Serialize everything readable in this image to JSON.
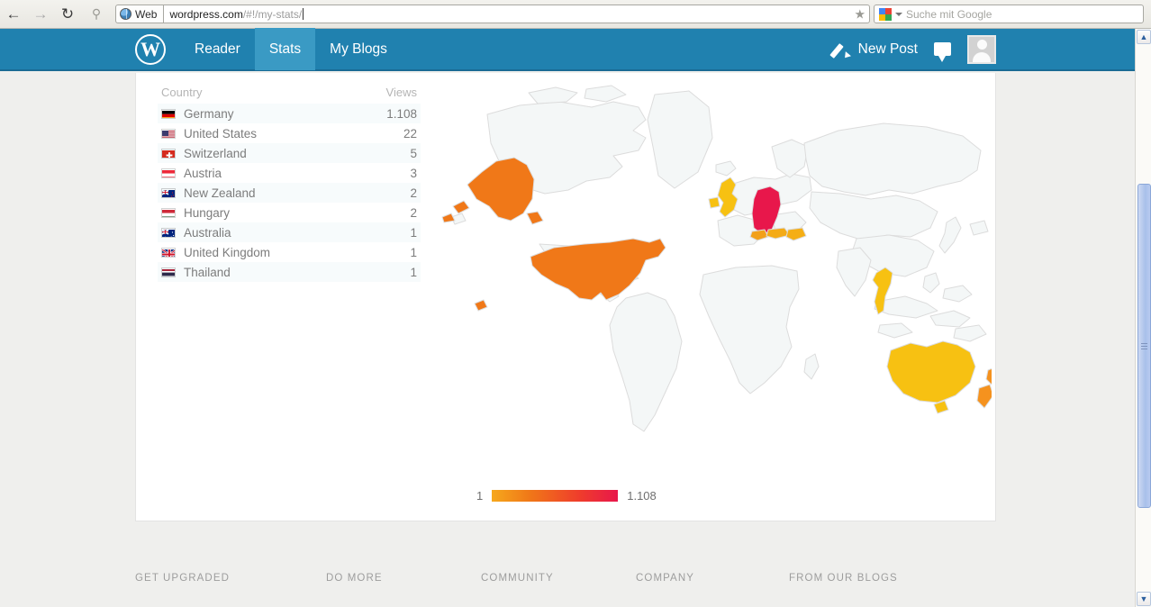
{
  "browser": {
    "back_icon": "back-arrow-icon",
    "forward_icon": "forward-arrow-icon",
    "reload_icon": "reload-icon",
    "key_icon": "key-icon",
    "web_chip_label": "Web",
    "url_main": "wordpress.com",
    "url_path": "/#!/my-stats/",
    "bookmark_icon": "star-icon",
    "search_placeholder": "Suche mit Google",
    "search_value": "",
    "search_engine_icon": "google-icon"
  },
  "header": {
    "logo": "W",
    "nav": [
      {
        "label": "Reader",
        "active": false
      },
      {
        "label": "Stats",
        "active": true
      },
      {
        "label": "My Blogs",
        "active": false
      }
    ],
    "new_post_label": "New Post",
    "new_post_icon": "pencil-icon",
    "notifications_icon": "speech-bubble-icon",
    "avatar_icon": "user-avatar-icon",
    "background_color": "#2081af",
    "active_tab_color": "#3a9ac4"
  },
  "stats": {
    "columns": {
      "country": "Country",
      "views": "Views"
    },
    "rows": [
      {
        "country": "Germany",
        "views": "1.108",
        "flag": "de"
      },
      {
        "country": "United States",
        "views": "22",
        "flag": "us"
      },
      {
        "country": "Switzerland",
        "views": "5",
        "flag": "ch"
      },
      {
        "country": "Austria",
        "views": "3",
        "flag": "at"
      },
      {
        "country": "New Zealand",
        "views": "2",
        "flag": "nz"
      },
      {
        "country": "Hungary",
        "views": "2",
        "flag": "hu"
      },
      {
        "country": "Australia",
        "views": "1",
        "flag": "au"
      },
      {
        "country": "United Kingdom",
        "views": "1",
        "flag": "gb"
      },
      {
        "country": "Thailand",
        "views": "1",
        "flag": "th"
      }
    ]
  },
  "chart_data": {
    "type": "heatmap",
    "title": "",
    "subtitle": "",
    "map_projection": "world-choropleth",
    "legend_position": "bottom-center",
    "legend_min_label": "1",
    "legend_max_label": "1.108",
    "scale_min": 1,
    "scale_max": 1108,
    "colormap": [
      "#f6a81c",
      "#f07818",
      "#ef3c2c",
      "#e8174b"
    ],
    "inactive_country_color": "#f4f7f7",
    "country_border_color": "#dcdcdc",
    "categories": [
      "Germany",
      "United States",
      "Switzerland",
      "Austria",
      "New Zealand",
      "Hungary",
      "Australia",
      "United Kingdom",
      "Thailand"
    ],
    "values": [
      1108,
      22,
      5,
      3,
      2,
      2,
      1,
      1,
      1
    ],
    "regions": [
      {
        "name": "Germany",
        "value": 1108,
        "color": "#e8174b"
      },
      {
        "name": "United States",
        "value": 22,
        "color": "#f07818"
      },
      {
        "name": "Switzerland",
        "value": 5,
        "color": "#f2a01a"
      },
      {
        "name": "Austria",
        "value": 3,
        "color": "#f4ab17"
      },
      {
        "name": "New Zealand",
        "value": 2,
        "color": "#f5ae15"
      },
      {
        "name": "Hungary",
        "value": 2,
        "color": "#f5ae15"
      },
      {
        "name": "Australia",
        "value": 1,
        "color": "#f7c112"
      },
      {
        "name": "United Kingdom",
        "value": 1,
        "color": "#f7c112"
      },
      {
        "name": "Thailand",
        "value": 1,
        "color": "#f7c112"
      }
    ]
  },
  "footer": {
    "columns": [
      "GET UPGRADED",
      "DO MORE",
      "COMMUNITY",
      "COMPANY",
      "FROM OUR BLOGS"
    ]
  },
  "scrollbar": {
    "up_icon": "chevron-up-icon",
    "down_icon": "chevron-down-icon"
  }
}
